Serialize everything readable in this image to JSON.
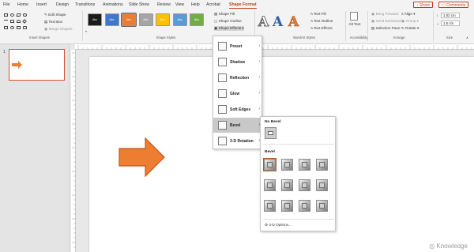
{
  "tabs": [
    "File",
    "Home",
    "Insert",
    "Design",
    "Transitions",
    "Animations",
    "Slide Show",
    "Review",
    "View",
    "Help",
    "Acrobat",
    "Shape Format"
  ],
  "active_tab": "Shape Format",
  "share": "Share",
  "comments": "Comments",
  "ribbon": {
    "edit_shape": "Edit Shape",
    "text_box": "Text Box",
    "merge_shapes": "Merge Shapes",
    "group_insert_shapes": "Insert Shapes",
    "style_swatches": [
      "Abc",
      "Abc",
      "Abc",
      "Abc",
      "Abc",
      "Abc",
      "Abc"
    ],
    "swatch_colors": [
      "#1a1a1a",
      "#3d78c9",
      "#ed7d31",
      "#a5a5a5",
      "#ffc000",
      "#5b9bd5",
      "#70ad47"
    ],
    "shape_fill": "Shape Fill",
    "shape_outline": "Shape Outline",
    "shape_effects": "Shape Effects",
    "group_shape_styles": "Shape Styles",
    "wordart_letters": [
      "A",
      "A",
      "A"
    ],
    "text_fill": "Text Fill",
    "text_outline": "Text Outline",
    "text_effects": "Text Effects",
    "group_wordart": "WordArt Styles",
    "alt_text": "Alt Text",
    "group_accessibility": "Accessibility",
    "bring_forward": "Bring Forward",
    "send_backward": "Send Backward",
    "selection_pane": "Selection Pane",
    "align": "Align",
    "group_btn": "Group",
    "rotate": "Rotate",
    "group_arrange": "Arrange",
    "height": "1.02 cm",
    "width": "1.5 cm",
    "group_size": "Size"
  },
  "thumb_number": "1",
  "effects_menu": [
    "Preset",
    "Shadow",
    "Reflection",
    "Glow",
    "Soft Edges",
    "Bevel",
    "3-D Rotation"
  ],
  "effects_highlight_index": 5,
  "bevel": {
    "no_bevel_heading": "No Bevel",
    "bevel_heading": "Bevel",
    "options": "3-D Options...",
    "grid_count": 12,
    "selected_index": 0
  },
  "arrow_color": "#ed7d31",
  "watermark": "Knowledge"
}
